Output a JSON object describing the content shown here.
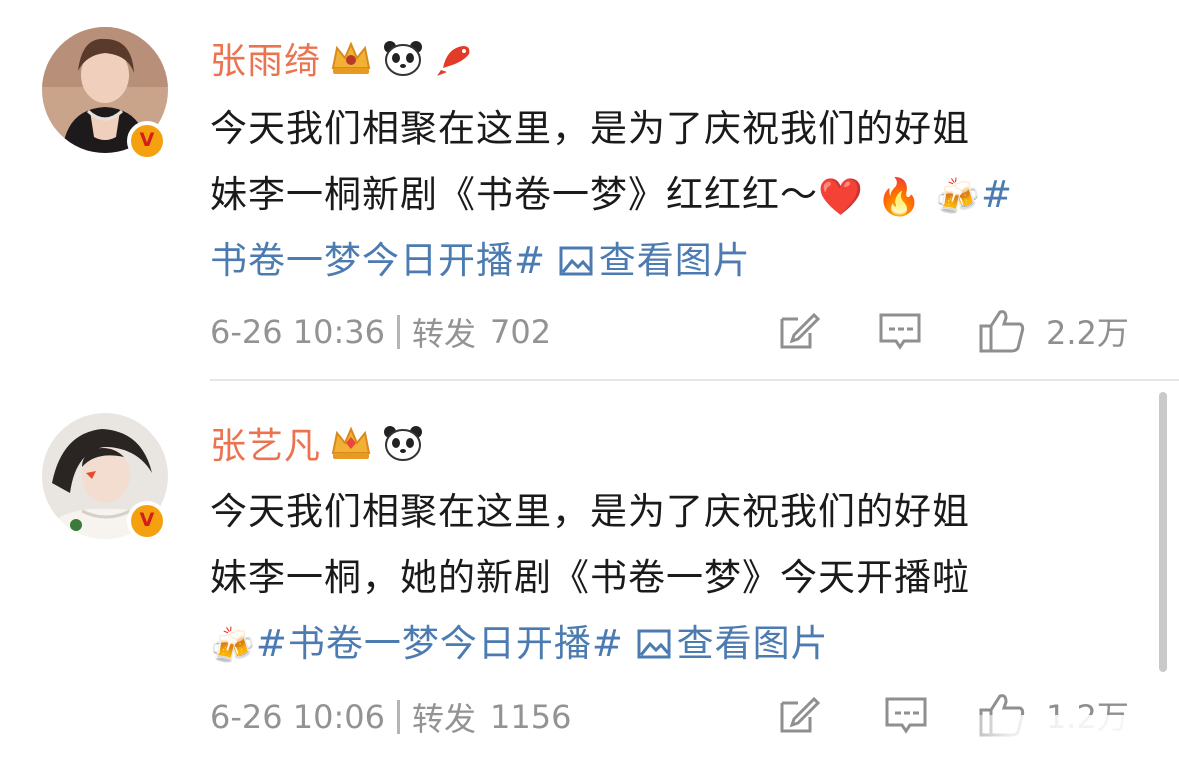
{
  "posts": [
    {
      "username": "张雨绮",
      "badges": [
        "crown-icon",
        "panda-icon",
        "koi-icon"
      ],
      "content": {
        "line1": "今天我们相聚在这里，是为了庆祝我们的好姐",
        "line2_text": "妹李一桐新剧《书卷一梦》红红红～",
        "emojis": [
          "❤️",
          "🔥",
          "🍻"
        ],
        "topic_part1": "#",
        "topic_part2": "书卷一梦今日开播#",
        "view_image": "查看图片"
      },
      "timestamp": "6-26 10:36",
      "repost_label": "转发",
      "repost_count": "702",
      "like_count": "2.2万"
    },
    {
      "username": "张艺凡",
      "badges": [
        "crown-icon",
        "panda-icon"
      ],
      "content": {
        "line1": "今天我们相聚在这里，是为了庆祝我们的好姐",
        "line2": "妹李一桐，她的新剧《书卷一梦》今天开播啦",
        "emoji": "🍻",
        "topic": "#书卷一梦今日开播#",
        "view_image": "查看图片"
      },
      "timestamp": "6-26 10:06",
      "repost_label": "转发",
      "repost_count": "1156",
      "like_count": "1.2万"
    }
  ],
  "colors": {
    "username": "#eb7350",
    "link": "#4b7bb0",
    "meta": "#939393",
    "verified_badge": "#f5a00f"
  }
}
